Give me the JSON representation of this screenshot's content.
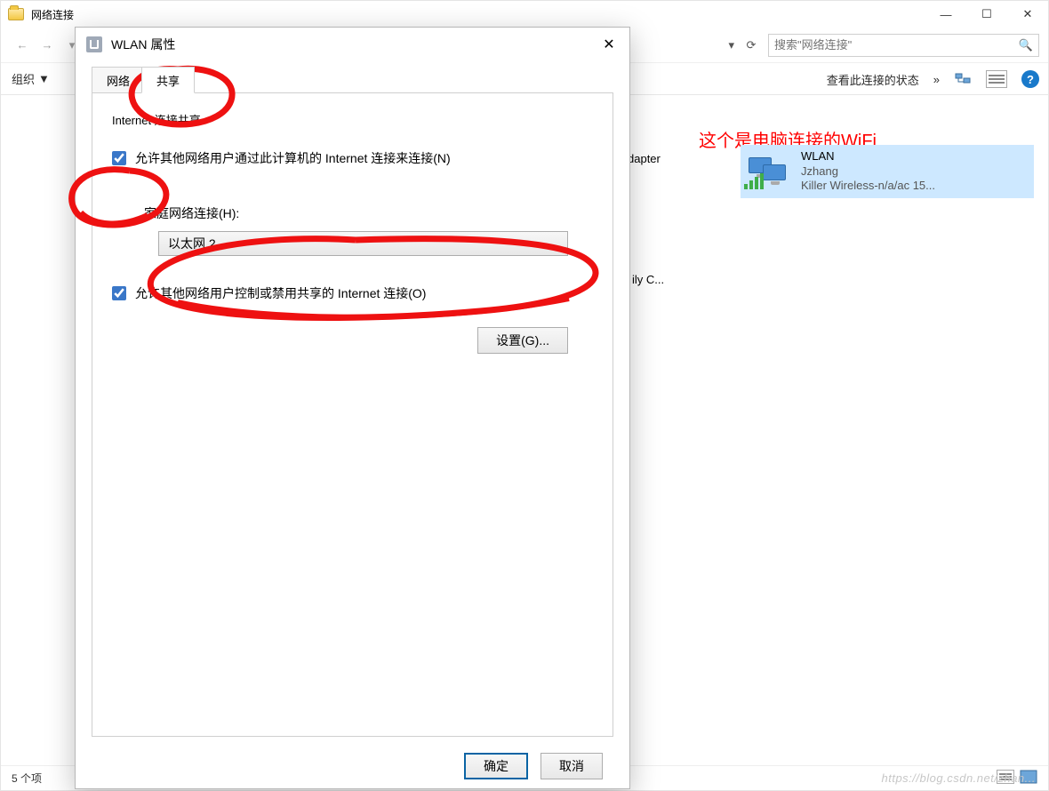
{
  "explorer": {
    "title": "网络连接",
    "controls": {
      "min": "—",
      "max": "☐",
      "close": "✕"
    },
    "nav": {
      "back": "←",
      "fwd": "→",
      "dropdown": "▾",
      "up": "↑",
      "refresh": "⟳"
    },
    "address_tail_chev": "▾",
    "search_placeholder": "搜索\"网络连接\"",
    "search_icon": "🔍",
    "toolbar": {
      "organize": "组织",
      "view_status_frag": "查看此连接的状态",
      "more": "»",
      "help": "?"
    },
    "body": {
      "adapter_frag": "dapter",
      "ilyc_frag": "ily C...",
      "wlan": {
        "name": "WLAN",
        "ssid": "Jzhang",
        "nic": "Killer Wireless-n/a/ac 15..."
      }
    },
    "annotation": "这个是电脑连接的WiFi",
    "status": "5 个项",
    "watermark": "https://blog.csdn.net/zhan..."
  },
  "dialog": {
    "title": "WLAN 属性",
    "close": "✕",
    "tabs": {
      "network": "网络",
      "share": "共享"
    },
    "group": "Internet 连接共享",
    "chk1": "允许其他网络用户通过此计算机的 Internet 连接来连接(N)",
    "home_label": "家庭网络连接(H):",
    "combo_value": "以太网 2",
    "chk2": "允许其他网络用户控制或禁用共享的 Internet 连接(O)",
    "settings_btn": "设置(G)...",
    "ok": "确定",
    "cancel": "取消"
  }
}
